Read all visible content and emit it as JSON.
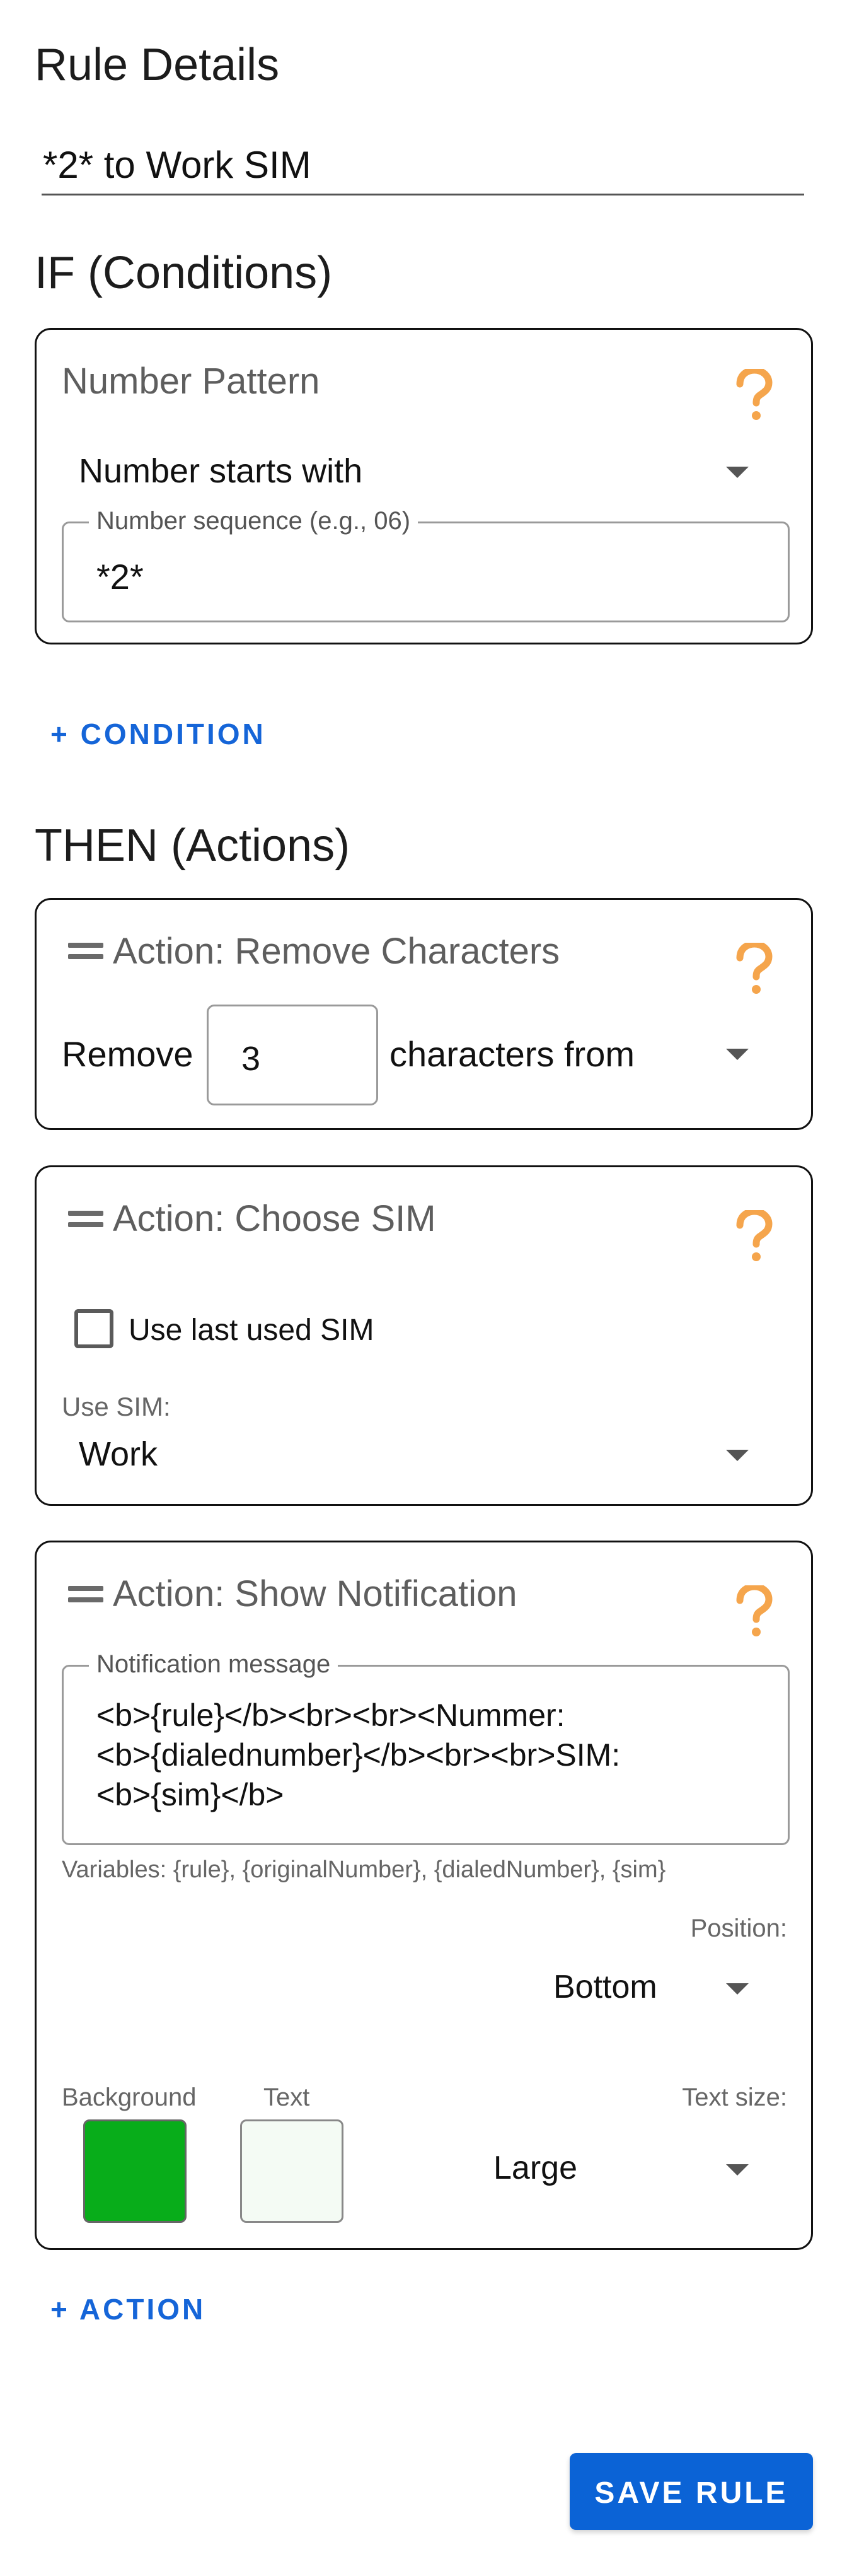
{
  "rule_details": {
    "title": "Rule Details",
    "rule_name_value": "*2* to Work SIM"
  },
  "conditions": {
    "title": "IF (Conditions)",
    "number_pattern": {
      "title": "Number Pattern",
      "match_type": "Number starts with",
      "sequence_label": "Number sequence (e.g., 06)",
      "sequence_value": "*2*"
    },
    "add_label": "+ CONDITION"
  },
  "actions": {
    "title": "THEN (Actions)",
    "remove_characters": {
      "title": "Action: Remove Characters",
      "prefix": "Remove",
      "count_value": "3",
      "suffix": "characters from"
    },
    "choose_sim": {
      "title": "Action: Choose SIM",
      "use_last_label": "Use last used SIM",
      "use_last_checked": false,
      "use_sim_label": "Use SIM:",
      "use_sim_value": "Work"
    },
    "show_notification": {
      "title": "Action: Show Notification",
      "message_label": "Notification message",
      "message_lines": [
        "<b>{rule}</b><br><br><Nummer:",
        "<b>{dialednumber}</b><br><br>SIM:",
        "<b>{sim}</b>"
      ],
      "variables_hint": "Variables: {rule}, {originalNumber}, {dialedNumber}, {sim}",
      "position_label": "Position:",
      "position_value": "Bottom",
      "background_label": "Background",
      "background_color": "#08ad1a",
      "text_label": "Text",
      "text_color": "#f4fbf4",
      "text_size_label": "Text size:",
      "text_size_value": "Large"
    },
    "add_label": "+ ACTION"
  },
  "save_label": "SAVE RULE",
  "colors": {
    "accent": "#1565d8",
    "save_button": "#0b63d6",
    "help_icon": "#f5a54c"
  }
}
